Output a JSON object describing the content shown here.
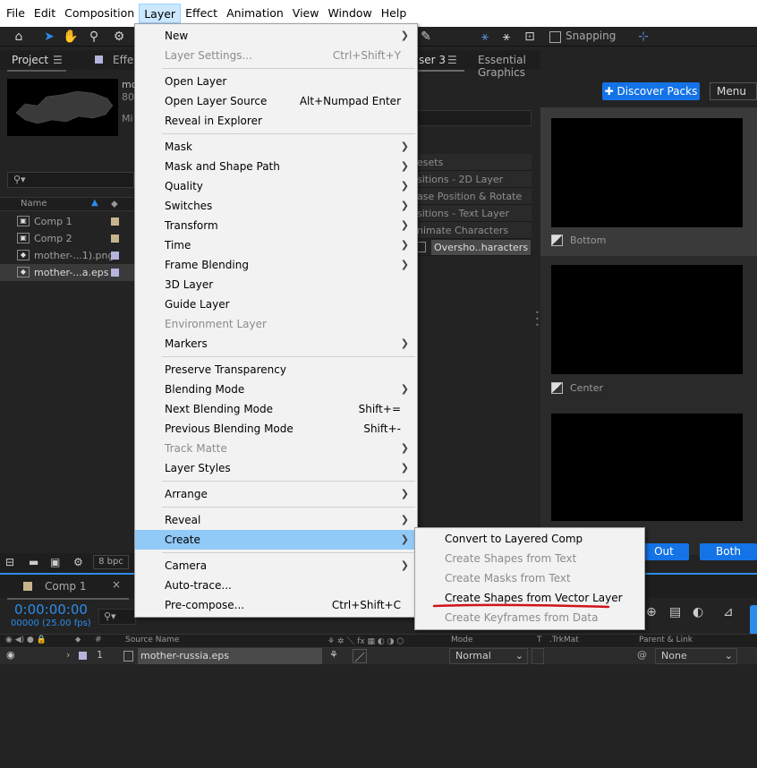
{
  "menubar": [
    "File",
    "Edit",
    "Composition",
    "Layer",
    "Effect",
    "Animation",
    "View",
    "Window",
    "Help"
  ],
  "toolbar": {
    "snapping_label": "Snapping"
  },
  "panels": {
    "project_tab": "Project",
    "effects_tab": "Effe",
    "composer_tab": "ser 3",
    "essential_tab": "Essential Graphics",
    "discover_label": "Discover Packs",
    "menu_label": "Menu",
    "comp_info_partial1": "mo",
    "comp_info_partial2": "80",
    "comp_info_partial3": "Mi"
  },
  "project": {
    "name_col": "Name",
    "search_placeholder": "",
    "items": [
      {
        "label": "Comp 1",
        "color": "#c8b48c"
      },
      {
        "label": "Comp 2",
        "color": "#c8b48c"
      },
      {
        "label": "mother-...1).png",
        "color": "#b4b4dc"
      },
      {
        "label": "mother-...a.eps",
        "color": "#b4b4dc"
      }
    ],
    "bpc": "8 bpc"
  },
  "presets": [
    "esets",
    "sitions - 2D Layer",
    "ase Position & Rotate",
    "sitions - Text Layer",
    "nimate Characters",
    "Oversho..haracters"
  ],
  "thumbs": [
    "Bottom",
    "Center"
  ],
  "buttons": {
    "out": "Out",
    "both": "Both"
  },
  "timeline": {
    "comp_tab": "Comp 1",
    "timecode": "0:00:00:00",
    "fps": "00000 (25.00 fps)",
    "col_source": "Source Name",
    "col_mode": "Mode",
    "col_t": "T",
    "col_trkmat": ".TrkMat",
    "col_parent": "Parent & Link",
    "layer_num": "1",
    "layer_name": "mother-russia.eps",
    "layer_mode": "Normal",
    "layer_parent": "None"
  },
  "layer_menu": {
    "items": [
      {
        "label": "New",
        "arrow": true
      },
      {
        "label": "Layer Settings...",
        "shortcut": "Ctrl+Shift+Y",
        "disabled": true
      },
      {
        "sep": true
      },
      {
        "label": "Open Layer"
      },
      {
        "label": "Open Layer Source",
        "shortcut": "Alt+Numpad Enter"
      },
      {
        "label": "Reveal in Explorer"
      },
      {
        "sep": true
      },
      {
        "label": "Mask",
        "arrow": true
      },
      {
        "label": "Mask and Shape Path",
        "arrow": true
      },
      {
        "label": "Quality",
        "arrow": true
      },
      {
        "label": "Switches",
        "arrow": true
      },
      {
        "label": "Transform",
        "arrow": true
      },
      {
        "label": "Time",
        "arrow": true
      },
      {
        "label": "Frame Blending",
        "arrow": true
      },
      {
        "label": "3D Layer"
      },
      {
        "label": "Guide Layer"
      },
      {
        "label": "Environment Layer",
        "disabled": true
      },
      {
        "label": "Markers",
        "arrow": true
      },
      {
        "sep": true
      },
      {
        "label": "Preserve Transparency"
      },
      {
        "label": "Blending Mode",
        "arrow": true
      },
      {
        "label": "Next Blending Mode",
        "shortcut": "Shift+="
      },
      {
        "label": "Previous Blending Mode",
        "shortcut": "Shift+-"
      },
      {
        "label": "Track Matte",
        "arrow": true,
        "disabled": true
      },
      {
        "label": "Layer Styles",
        "arrow": true
      },
      {
        "sep": true
      },
      {
        "label": "Arrange",
        "arrow": true
      },
      {
        "sep": true
      },
      {
        "label": "Reveal",
        "arrow": true
      },
      {
        "label": "Create",
        "arrow": true,
        "highlighted": true
      },
      {
        "sep": true
      },
      {
        "label": "Camera",
        "arrow": true
      },
      {
        "label": "Auto-trace..."
      },
      {
        "label": "Pre-compose...",
        "shortcut": "Ctrl+Shift+C"
      }
    ]
  },
  "create_menu": {
    "items": [
      {
        "label": "Convert to Layered Comp"
      },
      {
        "label": "Create Shapes from Text",
        "disabled": true
      },
      {
        "label": "Create Masks from Text",
        "disabled": true
      },
      {
        "label": "Create Shapes from Vector Layer"
      },
      {
        "label": "Create Keyframes from Data",
        "disabled": true
      }
    ]
  },
  "colors": {
    "accent": "#2d8ceb",
    "menu_highlight": "#91c9f7",
    "annotation_red": "#d0141a"
  }
}
